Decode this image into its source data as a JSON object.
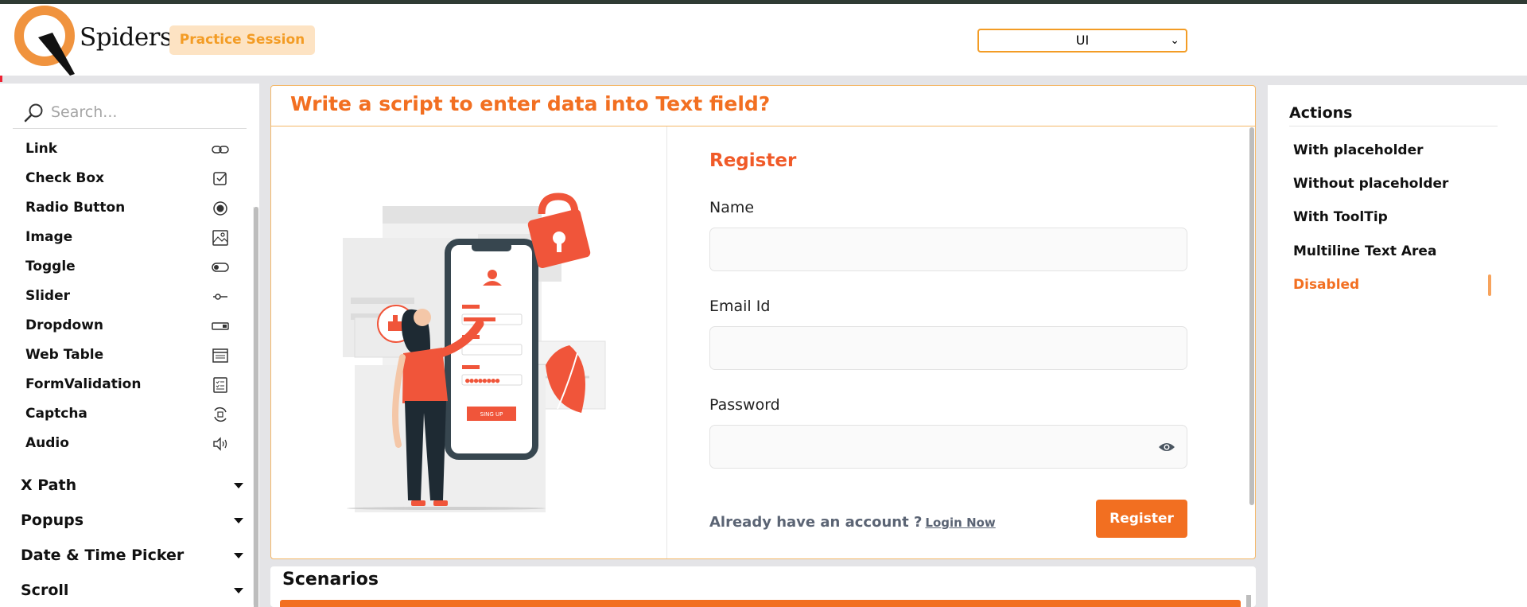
{
  "header": {
    "logo_text": "Spiders",
    "practice_label": "Practice Session",
    "select_value": "UI"
  },
  "sidebar": {
    "search_placeholder": "Search...",
    "items": [
      {
        "label": "Link",
        "icon": "link-icon"
      },
      {
        "label": "Check Box",
        "icon": "checkbox-icon"
      },
      {
        "label": "Radio Button",
        "icon": "radio-icon"
      },
      {
        "label": "Image",
        "icon": "image-icon"
      },
      {
        "label": "Toggle",
        "icon": "toggle-icon"
      },
      {
        "label": "Slider",
        "icon": "slider-icon"
      },
      {
        "label": "Dropdown",
        "icon": "dropdown-icon"
      },
      {
        "label": "Web Table",
        "icon": "table-icon"
      },
      {
        "label": "FormValidation",
        "icon": "form-icon"
      },
      {
        "label": "Captcha",
        "icon": "captcha-icon"
      },
      {
        "label": "Audio",
        "icon": "audio-icon"
      }
    ],
    "sections": [
      "X Path",
      "Popups",
      "Date & Time Picker",
      "Scroll"
    ]
  },
  "main": {
    "title": "Write a script to enter data into Text field?",
    "illustration_button": "SING UP",
    "form": {
      "title": "Register",
      "name_label": "Name",
      "email_label": "Email Id",
      "password_label": "Password",
      "account_text": "Already have an account ?",
      "login_link": "Login Now",
      "register_button": "Register"
    }
  },
  "scenarios": {
    "title": "Scenarios"
  },
  "actions": {
    "title": "Actions",
    "items": [
      "With placeholder",
      "Without placeholder",
      "With ToolTip",
      "Multiline Text Area",
      "Disabled"
    ],
    "active_index": 4
  },
  "colors": {
    "accent": "#f26f21",
    "badge_bg": "#fde3c3",
    "badge_text": "#f39c25"
  }
}
